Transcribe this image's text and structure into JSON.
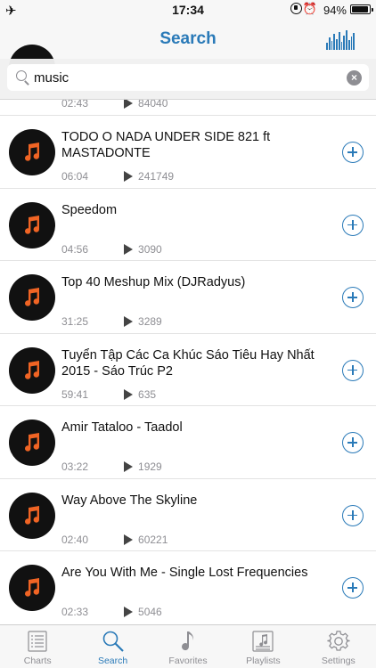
{
  "status_bar": {
    "time": "17:34",
    "battery_text": "94%",
    "battery_level": 0.94
  },
  "nav": {
    "title": "Search"
  },
  "search": {
    "value": "music",
    "clear_symbol": "×"
  },
  "ghost_row": {
    "duration": "02:43",
    "plays": "84040"
  },
  "results": [
    {
      "title": "TODO O NADA  UNDER SIDE 821 ft MASTADONTE",
      "duration": "06:04",
      "plays": "241749"
    },
    {
      "title": "Speedom",
      "duration": "04:56",
      "plays": "3090"
    },
    {
      "title": "Top 40 Meshup Mix (DJRadyus)",
      "duration": "31:25",
      "plays": "3289"
    },
    {
      "title": "Tuyển Tập Các Ca Khúc Sáo Tiêu Hay Nhất 2015 - Sáo Trúc P2",
      "duration": "59:41",
      "plays": "635"
    },
    {
      "title": "Amir Tataloo - Taadol",
      "duration": "03:22",
      "plays": "1929"
    },
    {
      "title": "Way Above The Skyline",
      "duration": "02:40",
      "plays": "60221"
    },
    {
      "title": "Are You With Me - Single Lost Frequencies",
      "duration": "02:33",
      "plays": "5046"
    }
  ],
  "tabs": [
    {
      "label": "Charts",
      "icon": "charts-icon"
    },
    {
      "label": "Search",
      "icon": "search-icon",
      "active": true
    },
    {
      "label": "Favorites",
      "icon": "music-note-icon"
    },
    {
      "label": "Playlists",
      "icon": "playlist-icon"
    },
    {
      "label": "Settings",
      "icon": "gear-icon"
    }
  ],
  "colors": {
    "accent": "#2a7ab8",
    "note_orange": "#f06424",
    "disc": "#111111"
  }
}
